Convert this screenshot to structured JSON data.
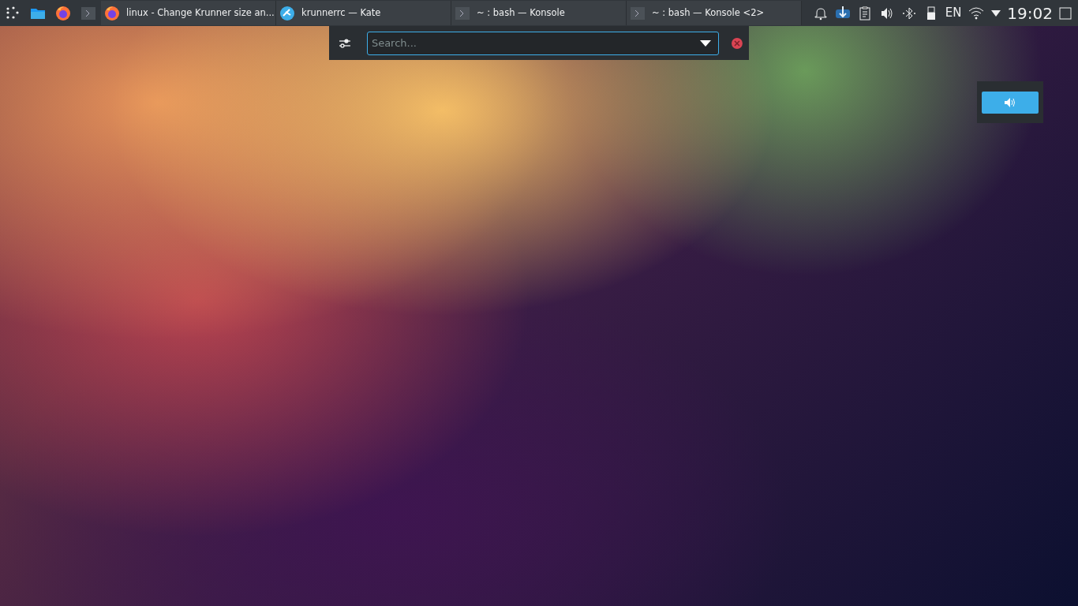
{
  "taskbar": {
    "launchers": [
      {
        "kind": "menu"
      },
      {
        "kind": "files"
      },
      {
        "kind": "browser"
      },
      {
        "kind": "terminal"
      }
    ],
    "tasks": [
      {
        "kind": "browser",
        "title": "linux - Change Krunner size an...",
        "selected": false
      },
      {
        "kind": "editor",
        "title": "krunnerrc  — Kate",
        "selected": false
      },
      {
        "kind": "terminal",
        "title": "~ : bash — Konsole",
        "selected": false
      },
      {
        "kind": "terminal",
        "title": "~ : bash — Konsole <2>",
        "selected": false
      }
    ],
    "tray": [
      {
        "kind": "bell"
      },
      {
        "kind": "update"
      },
      {
        "kind": "clipboard"
      },
      {
        "kind": "volume"
      },
      {
        "kind": "bluetooth"
      },
      {
        "kind": "usb"
      }
    ],
    "keyboard_layout": "EN",
    "clock": "19:02"
  },
  "runner": {
    "placeholder": "Search..."
  },
  "volume_osd": {
    "level": 1
  }
}
